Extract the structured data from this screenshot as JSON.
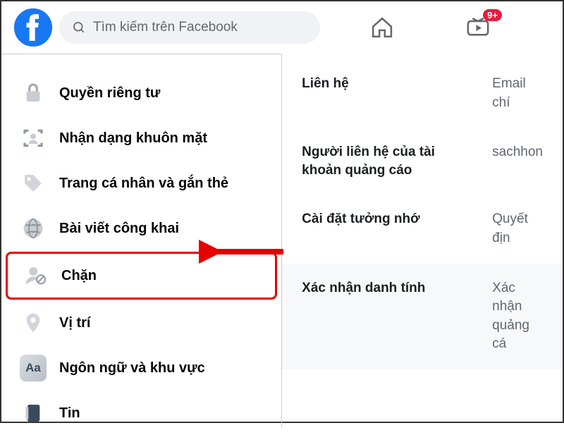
{
  "header": {
    "search_placeholder": "Tìm kiếm trên Facebook",
    "watch_badge": "9+"
  },
  "sidebar": {
    "items": [
      {
        "label": "Quyền riêng tư"
      },
      {
        "label": "Nhận dạng khuôn mặt"
      },
      {
        "label": "Trang cá nhân và gắn thẻ"
      },
      {
        "label": "Bài viết công khai"
      },
      {
        "label": "Chặn"
      },
      {
        "label": "Vị trí"
      },
      {
        "label": "Ngôn ngữ và khu vực"
      },
      {
        "label": "Tin"
      }
    ]
  },
  "main": {
    "rows": [
      {
        "label": "Liên hệ",
        "value": "Email chí"
      },
      {
        "label": "Người liên hệ của tài khoản quảng cáo",
        "value": "sachhon"
      },
      {
        "label": "Cài đặt tưởng nhớ",
        "value": "Quyết địn"
      },
      {
        "label": "Xác nhận danh tính",
        "value": "Xác nhận quảng cá"
      }
    ]
  },
  "icons": {
    "aa": "Aa"
  }
}
